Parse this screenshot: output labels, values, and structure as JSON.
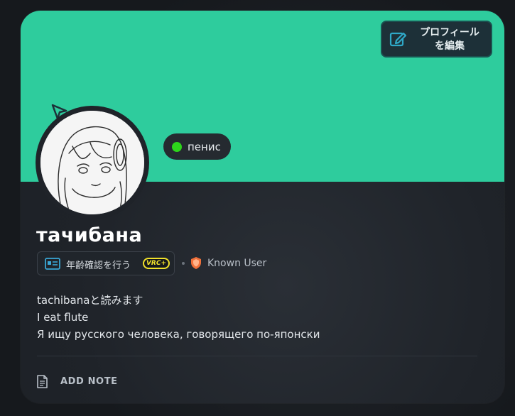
{
  "header": {
    "edit_profile_label": "プロフィール\nを編集"
  },
  "profile": {
    "status_text": "пенис",
    "status_color": "#2dd51b",
    "username": "тачибана",
    "age_verify_label": "年齢確認を行う",
    "vrc_badge": "VRC+",
    "trust_rank": "Known User",
    "bio_lines": [
      "tachibanaと読みます",
      "I eat flute",
      "Я ищу русского человека, говорящего по-японски"
    ],
    "add_note_label": "ADD NOTE"
  },
  "colors": {
    "banner": "#2ecc9d",
    "card_bg": "#1f2329",
    "vrc_badge": "#f1e12a",
    "trust_shield": "#f0703a"
  },
  "icons": {
    "edit": "edit-icon",
    "cursor": "cursor-icon",
    "id_card": "id-card-icon",
    "shield": "shield-icon",
    "note": "note-icon"
  }
}
